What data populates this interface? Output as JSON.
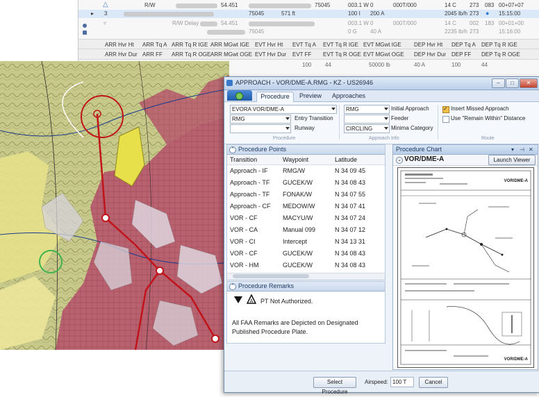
{
  "background_grid": {
    "rows": [
      {
        "arrow": "",
        "col1": "R/W",
        "col2": "54.451",
        "col3": "75045",
        "col4": "003.1 W",
        "col5": "0",
        "col6": "000T/000",
        "col7": "14 C",
        "col8": "273",
        "col9": "083",
        "col10": "00+07+07"
      },
      {
        "arrow": "▸",
        "col1": "3",
        "col2": "75045",
        "col3": "571 ft",
        "col4": "100 I",
        "col5": "200 A",
        "col6": "",
        "col7": "2045 lb/h",
        "col8": "273",
        "col9": "",
        "col10": "15:15:00"
      },
      {
        "arrow": "",
        "col1": "R/W Delay",
        "col2": "54.451",
        "col3": "75045",
        "col4": "003.1 W",
        "col5": "0",
        "col6": "000T/000",
        "col7": "14 C",
        "col8": "002",
        "col9": "183",
        "col10": "00+01+00"
      },
      {
        "arrow": "",
        "col1": "",
        "col2": "75045",
        "col3": "",
        "col4": "0 G",
        "col5": "40 A",
        "col6": "",
        "col7": "2235 lb/h",
        "col8": "273",
        "col9": "",
        "col10": "15:16:00"
      }
    ],
    "header1": [
      "ARR Hvr Ht",
      "ARR Tq A",
      "ARR Tq R IGE",
      "ARR MGwt IGE",
      "EVT Hvr Ht",
      "EVT Tq A",
      "EVT Tq R IGE",
      "EVT MGwt IGE",
      "DEP Hvr Ht",
      "DEP Tq A",
      "DEP Tq R IGE"
    ],
    "header2": [
      "ARR Hvr Dur",
      "ARR FF",
      "ARR Tq R OGE",
      "ARR MGwt OGE",
      "EVT Hvr Dur",
      "EVT FF",
      "EVT Tq R OGE",
      "EVT MGwt OGE",
      "DEP Hvr Dur",
      "DEP FF",
      "DEP Tq R OGE"
    ],
    "partial_row": [
      "100",
      "44",
      "50000 lb",
      "40 A",
      "100",
      "44"
    ]
  },
  "window": {
    "title": "APPROACH - VOR/DME-A.RMG - KZ - US26946",
    "controls": {
      "minimize": "–",
      "maximize": "□",
      "close": "✕"
    }
  },
  "ribbon": {
    "tabs": [
      "Procedure",
      "Preview",
      "Approaches"
    ],
    "procedure_group": {
      "procedure_combo": "EVORA  VOR/DME-A",
      "transition_combo": "RMG",
      "transition_label": "Entry Transition",
      "runway_combo": "",
      "runway_label": "Runway",
      "group_label": "Procedure"
    },
    "approach_info_group": {
      "initial_approach_combo": "RMG",
      "initial_approach_label": "Initial Approach",
      "feeder_combo": "",
      "feeder_label": "Feeder",
      "minima_combo": "CIRCLING",
      "minima_label": "Minima Category",
      "group_label": "Approach Info"
    },
    "route_group": {
      "insert_missed_label": "Insert Missed Approach",
      "insert_missed_checked": true,
      "remain_within_label": "Use \"Remain Within\" Distance",
      "remain_within_checked": false,
      "group_label": "Route"
    }
  },
  "procedure_points": {
    "title": "Procedure Points",
    "columns": [
      "Transition",
      "Waypoint",
      "Latitude"
    ],
    "rows": [
      [
        "Approach - IF",
        "RMG/W",
        "N 34 09 45"
      ],
      [
        "Approach - TF",
        "GUCEK/W",
        "N 34 08 43"
      ],
      [
        "Approach - TF",
        "FONAK/W",
        "N 34 07 55"
      ],
      [
        "Approach - CF",
        "MEDOW/W",
        "N 34 07 41"
      ],
      [
        "VOR - CF",
        "MACYU/W",
        "N 34 07 24"
      ],
      [
        "VOR - CA",
        "Manual 099",
        "N 34 07 12"
      ],
      [
        "VOR - CI",
        "Intercept",
        "N 34 13 31"
      ],
      [
        "VOR - CF",
        "GUCEK/W",
        "N 34 08 43"
      ],
      [
        "VOR - HM",
        "GUCEK/W",
        "N 34 08 43"
      ]
    ]
  },
  "procedure_remarks": {
    "title": "Procedure Remarks",
    "pt_text": "PT Not Authorized.",
    "faa_text_line1": "All FAA Remarks are Depicted on Designated",
    "faa_text_line2": "Published Procedure Plate."
  },
  "procedure_chart": {
    "title": "Procedure Chart",
    "chart_name": "VOR/DME-A",
    "launch_viewer_label": "Launch Viewer",
    "plate_label_top": "VOR/DME-A",
    "plate_label_bottom": "VOR/DME-A"
  },
  "footer": {
    "select_procedure_label": "Select Procedure",
    "airspeed_label": "Airspeed:",
    "airspeed_value": "100 T",
    "cancel_label": "Cancel"
  },
  "colors": {
    "route_red": "#c0141a",
    "window_accent": "#6d8bb1",
    "checkbox_accent": "#f0c14b"
  }
}
